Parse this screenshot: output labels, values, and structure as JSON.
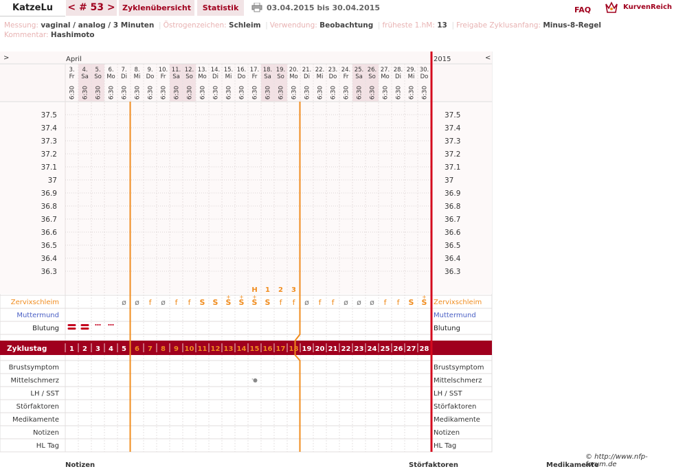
{
  "header": {
    "user": "KatzeLu",
    "cycle_nav": "< # 53 >",
    "tab_overview": "Zyklenübersicht",
    "tab_statistics": "Statistik",
    "date_range": "03.04.2015 bis 30.04.2015",
    "faq": "FAQ",
    "brand": "KurvenReich"
  },
  "meta": {
    "row1": [
      {
        "k": "Messung:",
        "v": "vaginal / analog / 3 Minuten"
      },
      {
        "k": "Östrogenzeichen:",
        "v": "Schleim"
      },
      {
        "k": "Verwendung:",
        "v": "Beobachtung"
      },
      {
        "k": "früheste 1.hM:",
        "v": "13"
      },
      {
        "k": "Freigabe Zyklusanfang:",
        "v": "Minus-8-Regel"
      }
    ],
    "row2": [
      {
        "k": "Kommentar:",
        "v": "Hashimoto"
      }
    ]
  },
  "chart_data": {
    "type": "table",
    "month_label": "April",
    "year_label": "2015",
    "nav_left": ">",
    "nav_right": "<",
    "days": [
      {
        "d": "3.",
        "w": "Fr",
        "we": false
      },
      {
        "d": "4.",
        "w": "Sa",
        "we": true
      },
      {
        "d": "5.",
        "w": "So",
        "we": true
      },
      {
        "d": "6.",
        "w": "Mo",
        "we": false
      },
      {
        "d": "7.",
        "w": "Di",
        "we": false
      },
      {
        "d": "8.",
        "w": "Mi",
        "we": false
      },
      {
        "d": "9.",
        "w": "Do",
        "we": false
      },
      {
        "d": "10.",
        "w": "Fr",
        "we": false
      },
      {
        "d": "11.",
        "w": "Sa",
        "we": true
      },
      {
        "d": "12.",
        "w": "So",
        "we": true
      },
      {
        "d": "13.",
        "w": "Mo",
        "we": false
      },
      {
        "d": "14.",
        "w": "Di",
        "we": false
      },
      {
        "d": "15.",
        "w": "Mi",
        "we": false
      },
      {
        "d": "16.",
        "w": "Do",
        "we": false
      },
      {
        "d": "17.",
        "w": "Fr",
        "we": false
      },
      {
        "d": "18.",
        "w": "Sa",
        "we": true
      },
      {
        "d": "19.",
        "w": "So",
        "we": true
      },
      {
        "d": "20.",
        "w": "Mo",
        "we": false
      },
      {
        "d": "21.",
        "w": "Di",
        "we": false
      },
      {
        "d": "22.",
        "w": "Mi",
        "we": false
      },
      {
        "d": "23.",
        "w": "Do",
        "we": false
      },
      {
        "d": "24.",
        "w": "Fr",
        "we": false
      },
      {
        "d": "25.",
        "w": "Sa",
        "we": true
      },
      {
        "d": "26.",
        "w": "So",
        "we": true
      },
      {
        "d": "27.",
        "w": "Mo",
        "we": false
      },
      {
        "d": "28.",
        "w": "Di",
        "we": false
      },
      {
        "d": "29.",
        "w": "Mi",
        "we": false
      },
      {
        "d": "30.",
        "w": "Do",
        "we": false
      }
    ],
    "time": "6:30",
    "temps": [
      "37.5",
      "37.4",
      "37.3",
      "37.2",
      "37.1",
      "37",
      "36.9",
      "36.8",
      "36.7",
      "36.6",
      "36.5",
      "36.4",
      "36.3"
    ],
    "peak_marks": [
      {
        "day": 15,
        "t": "H"
      },
      {
        "day": 16,
        "t": "1"
      },
      {
        "day": 17,
        "t": "2"
      },
      {
        "day": 18,
        "t": "3"
      }
    ],
    "mucus_label": "Zervixschleim",
    "cervix_label": "Muttermund",
    "bleeding_label": "Blutung",
    "cycle_label": "Zyklustag",
    "mucus": [
      "",
      "",
      "",
      "",
      "ø",
      "ø",
      "f",
      "ø",
      "f",
      "f",
      "S",
      "S",
      "S+",
      "S+",
      "S+",
      "S",
      "f",
      "f",
      "ø",
      "f",
      "f",
      "ø",
      "ø",
      "ø",
      "f",
      "f",
      "S",
      "S+"
    ],
    "bleeding": [
      "heavy",
      "heavy",
      "light",
      "light",
      "",
      "",
      "",
      "",
      "",
      "",
      "",
      "",
      "",
      "",
      "",
      "",
      "",
      "",
      "",
      "",
      "",
      "",
      "",
      "",
      "",
      "",
      "",
      ""
    ],
    "cycle_days": [
      "1",
      "2",
      "3",
      "4",
      "5",
      "6",
      "7",
      "8",
      "9",
      "10",
      "11",
      "12",
      "13",
      "14",
      "15",
      "16",
      "17",
      "18",
      "19",
      "20",
      "21",
      "22",
      "23",
      "24",
      "25",
      "26",
      "27",
      "28"
    ],
    "lower_rows": [
      "Brustsymptom",
      "Mittelschmerz",
      "LH / SST",
      "Störfaktoren",
      "Medikamente",
      "Notizen",
      "HL Tag"
    ],
    "mittelschmerz_day": 15,
    "line_after_day": 5,
    "line_second_day": 18
  },
  "footer": {
    "copyright": "© http://www.nfp-forum.de",
    "col1": "Notizen",
    "col2": "Störfaktoren",
    "col3": "Medikamente"
  },
  "colors": {
    "accent": "#a0001e",
    "orange": "#f08c1e",
    "blue": "#4a5fc4"
  }
}
